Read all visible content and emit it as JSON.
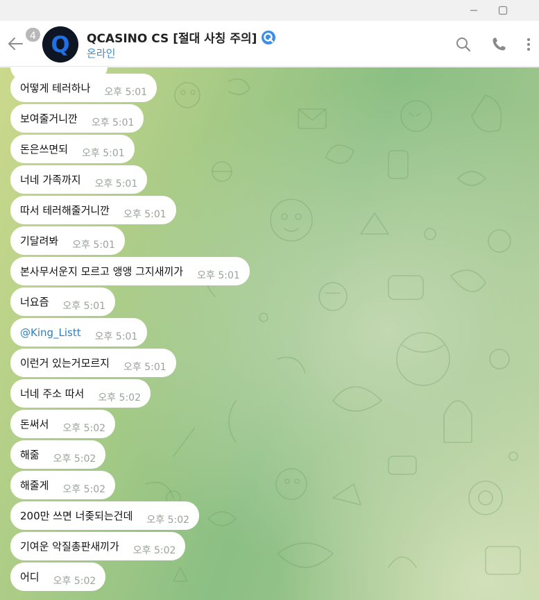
{
  "window": {
    "controls": [
      "minimize",
      "maximize"
    ]
  },
  "header": {
    "unread_count": "4",
    "title": "QCASINO CS [절대 사칭 주의]",
    "status": "온라인",
    "avatar_letter": "Q"
  },
  "messages": [
    {
      "text": "어떻게 테러하나",
      "time": "오후 5:01"
    },
    {
      "text": "보여줄거니깐",
      "time": "오후 5:01"
    },
    {
      "text": "돈은쓰면되",
      "time": "오후 5:01"
    },
    {
      "text": "너네 가족까지",
      "time": "오후 5:01"
    },
    {
      "text": "따서 테러해줄거니깐",
      "time": "오후 5:01"
    },
    {
      "text": "기달려봐",
      "time": "오후 5:01"
    },
    {
      "text": "본사무서운지 모르고 앵앵 그지새끼가",
      "time": "오후 5:01"
    },
    {
      "text": "너요즘",
      "time": "오후 5:01"
    },
    {
      "text": "@King_Listt",
      "time": "오후 5:01",
      "mention": true
    },
    {
      "text": "이런거 있는거모르지",
      "time": "오후 5:01"
    },
    {
      "text": "너네 주소 따서",
      "time": "오후 5:02"
    },
    {
      "text": "돈써서",
      "time": "오후 5:02"
    },
    {
      "text": "해줆",
      "time": "오후 5:02"
    },
    {
      "text": "해줄게",
      "time": "오후 5:02"
    },
    {
      "text": "200만 쓰면 너좆되는건데",
      "time": "오후 5:02"
    },
    {
      "text": "기여운 악질총판새끼가",
      "time": "오후 5:02"
    },
    {
      "text": "어디",
      "time": "오후 5:02"
    }
  ],
  "colors": {
    "accent": "#3a8fd6",
    "verified": "#3d8ee8",
    "bubble": "#ffffff",
    "mention": "#2f7fc0"
  },
  "icons": [
    "back-arrow-icon",
    "verified-q-icon",
    "search-icon",
    "phone-icon",
    "more-vert-icon",
    "minimize-icon",
    "maximize-icon"
  ]
}
